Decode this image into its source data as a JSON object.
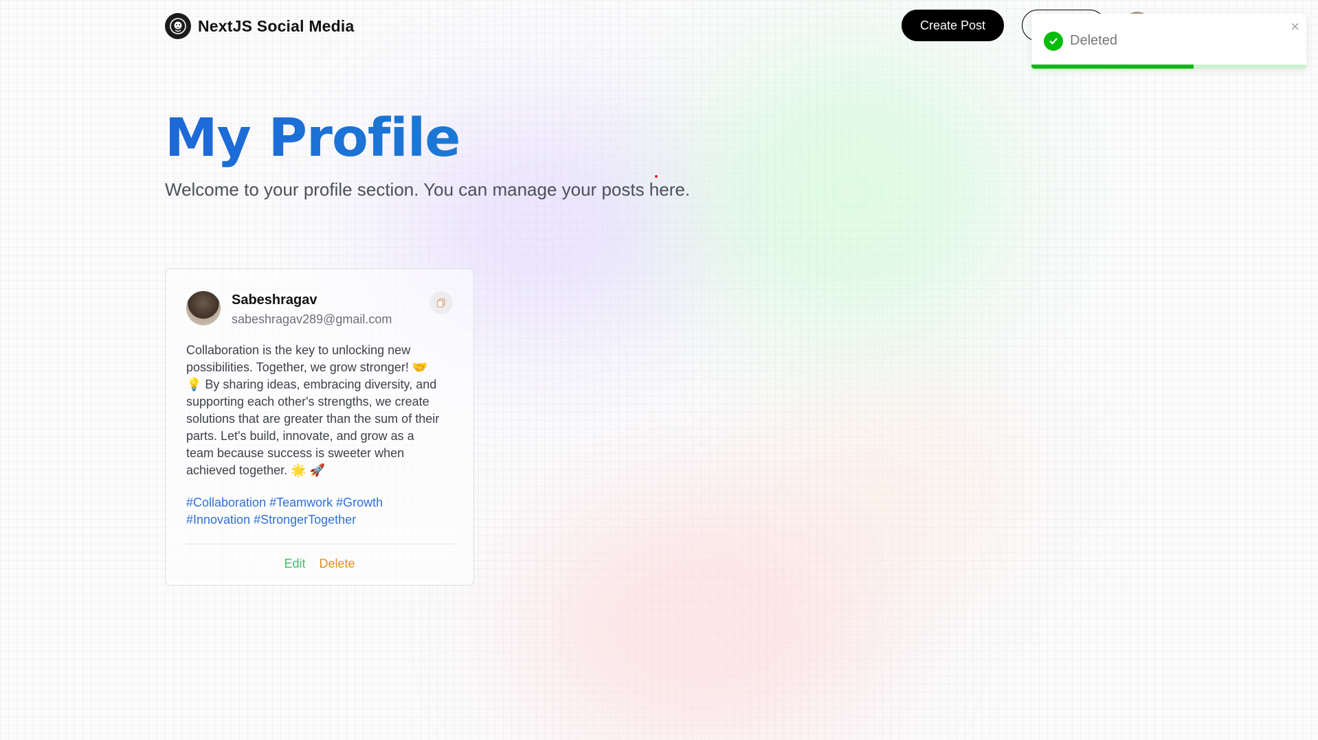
{
  "brand": {
    "name": "NextJS Social Media",
    "icon": "lion-logo-icon"
  },
  "nav": {
    "create_post_label": "Create Post",
    "outline_button_label": "",
    "avatar_icon": "user-avatar"
  },
  "hero": {
    "title": "My Profile",
    "subtitle": "Welcome to your profile section. You can manage your posts here."
  },
  "post": {
    "username": "Sabeshragav",
    "email": "sabeshragav289@gmail.com",
    "body": "Collaboration is the key to unlocking new possibilities. Together, we grow stronger! 🤝 💡 By sharing ideas, embracing diversity, and supporting each other's strengths, we create solutions that are greater than the sum of their parts. Let's build, innovate, and grow as a team because success is sweeter when achieved together. 🌟 🚀",
    "tags": [
      "#Collaboration",
      "#Teamwork",
      "#Growth",
      "#Innovation",
      "#StrongerTogether"
    ],
    "edit_label": "Edit",
    "delete_label": "Delete",
    "copy_icon": "copy-icon"
  },
  "toast": {
    "message": "Deleted",
    "icon": "check-circle-icon",
    "close_icon": "close-icon",
    "progress": 0.59,
    "color": "#07bc0c"
  },
  "colors": {
    "title_gradient_start": "#1d68d8",
    "title_gradient_end": "#16a0c8",
    "edit": "#3fbb63",
    "delete": "#e09022",
    "tag": "#2e6fd6"
  }
}
